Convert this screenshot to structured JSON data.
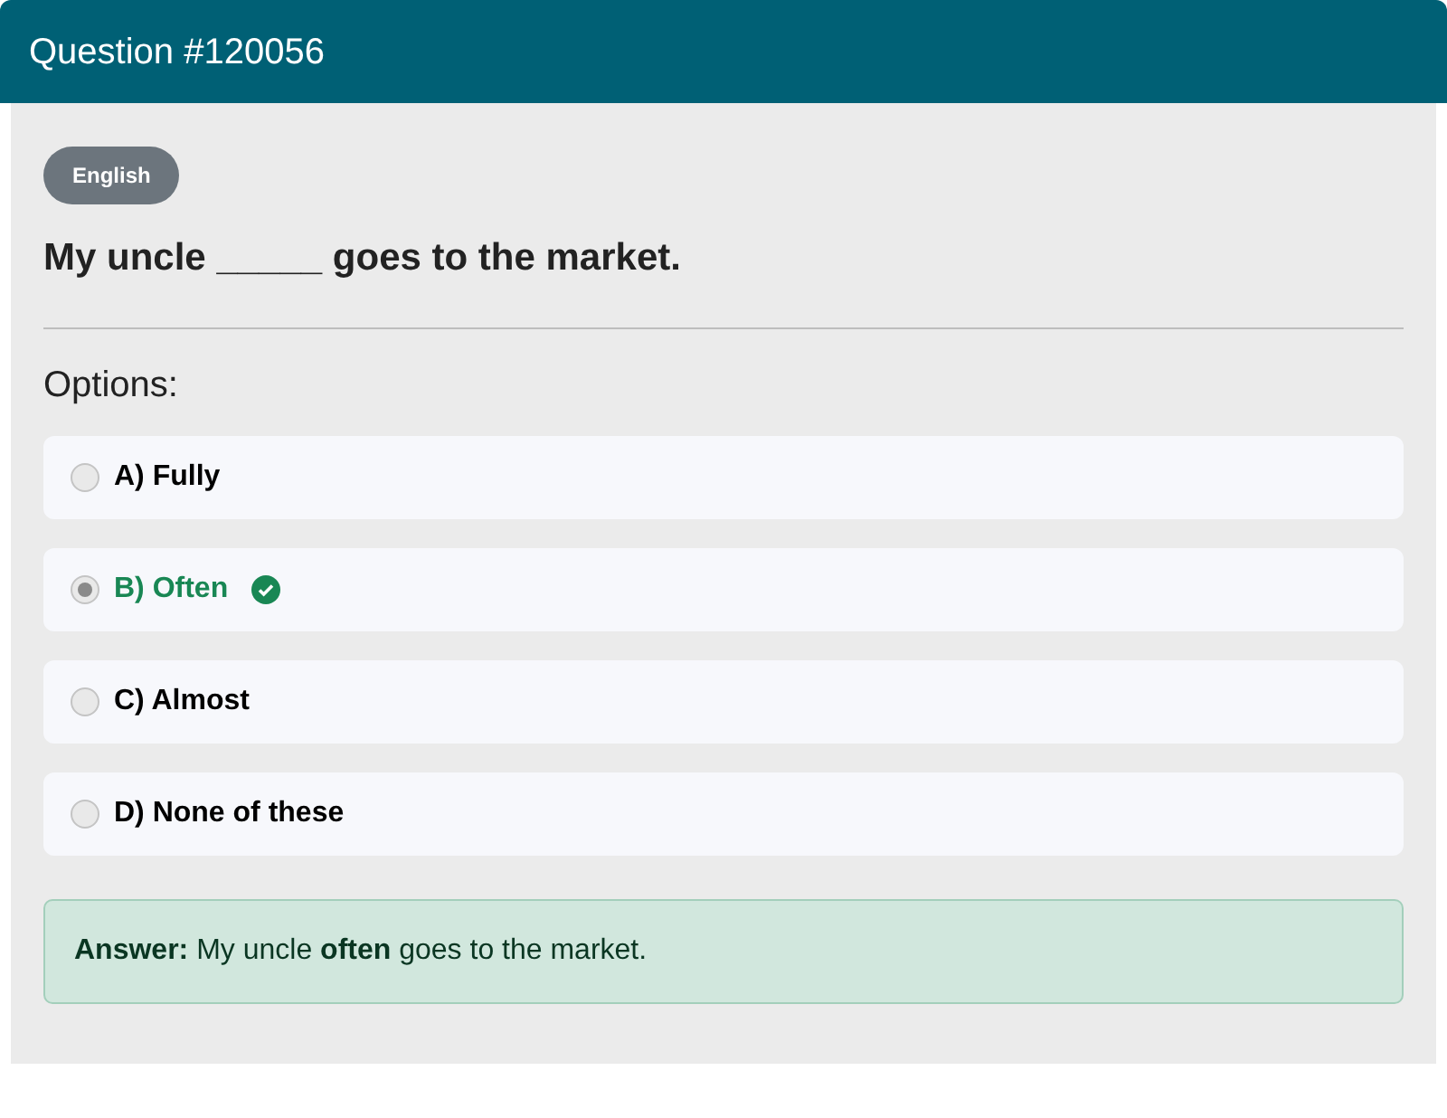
{
  "header": {
    "title": "Question #120056"
  },
  "badge": "English",
  "question": "My uncle _____ goes to the market.",
  "options_label": "Options:",
  "options": [
    {
      "label": "A) Fully",
      "selected": false
    },
    {
      "label": "B) Often",
      "selected": true
    },
    {
      "label": "C) Almost",
      "selected": false
    },
    {
      "label": "D) None of these",
      "selected": false
    }
  ],
  "answer": "**Answer:** My uncle **often** goes to the market."
}
